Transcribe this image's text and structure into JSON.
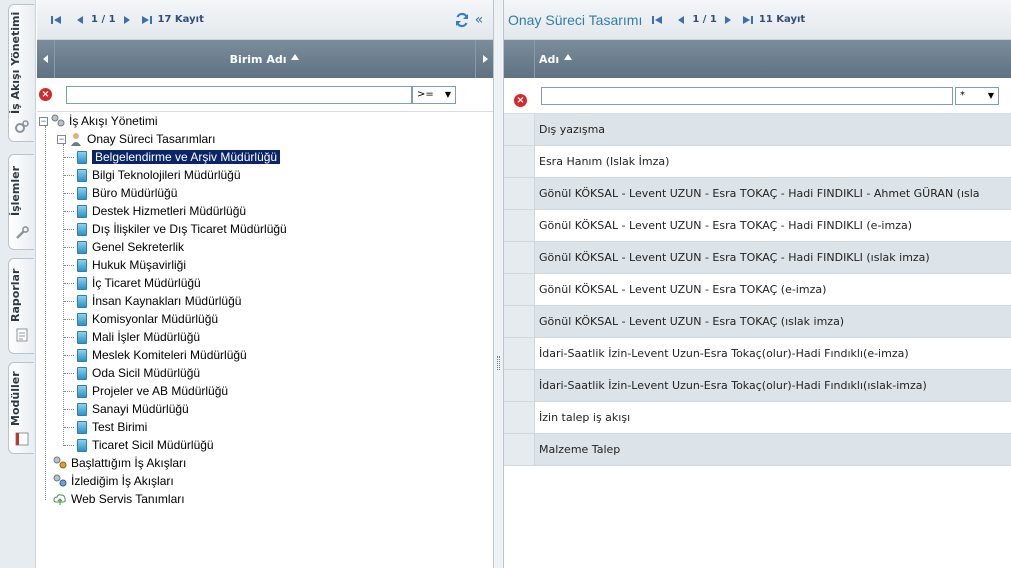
{
  "vertical_tabs": [
    {
      "label": "İş Akışı Yönetimi",
      "icon": "gears-icon"
    },
    {
      "label": "İşlemler",
      "icon": "wrench-icon"
    },
    {
      "label": "Raporlar",
      "icon": "report-icon"
    },
    {
      "label": "Modüller",
      "icon": "module-icon"
    }
  ],
  "left": {
    "page_info": "1 / 1",
    "count": "17 Kayıt",
    "column_header": "Birim Adı",
    "filter_value": "",
    "filter_op": ">=",
    "tree": {
      "root": "İş Akışı Yönetimi",
      "group": "Onay Süreci Tasarımları",
      "children": [
        "Belgelendirme ve Arşiv Müdürlüğü",
        "Bilgi Teknolojileri Müdürlüğü",
        "Büro Müdürlüğü",
        "Destek Hizmetleri Müdürlüğü",
        "Dış İlişkiler ve Dış Ticaret Müdürlüğü",
        "Genel Sekreterlik",
        "Hukuk Müşavirliği",
        "İç Ticaret Müdürlüğü",
        "İnsan Kaynakları Müdürlüğü",
        "Komisyonlar Müdürlüğü",
        "Mali İşler Müdürlüğü",
        "Meslek Komiteleri Müdürlüğü",
        "Oda Sicil Müdürlüğü",
        "Projeler ve AB Müdürlüğü",
        "Sanayi Müdürlüğü",
        "Test Birimi",
        "Ticaret Sicil Müdürlüğü"
      ],
      "selected_index": 0,
      "siblings": [
        "Başlattığım İş Akışları",
        "İzlediğim İş Akışları",
        "Web Servis Tanımları"
      ]
    }
  },
  "right": {
    "title": "Onay Süreci Tasarımı",
    "page_info": "1 / 1",
    "count": "11 Kayıt",
    "column_header": "Adı",
    "filter_value": "",
    "filter_op": "*",
    "rows": [
      "Dış yazışma",
      "Esra Hanım (Islak İmza)",
      "Gönül KÖKSAL - Levent UZUN - Esra TOKAÇ - Hadi FINDIKLI - Ahmet GÜRAN (ısla",
      "Gönül KÖKSAL - Levent UZUN - Esra TOKAÇ - Hadi FINDIKLI (e-imza)",
      "Gönül KÖKSAL - Levent UZUN - Esra TOKAÇ - Hadi FINDIKLI (ıslak imza)",
      "Gönül KÖKSAL - Levent UZUN - Esra TOKAÇ (e-imza)",
      "Gönül KÖKSAL - Levent UZUN - Esra TOKAÇ (ıslak imza)",
      "İdari-Saatlik İzin-Levent Uzun-Esra Tokaç(olur)-Hadi Fındıklı(e-imza)",
      "İdari-Saatlik İzin-Levent Uzun-Esra Tokaç(olur)-Hadi Fındıklı(ıslak-imza)",
      "İzin talep iş akışı",
      "Malzeme Talep"
    ]
  }
}
